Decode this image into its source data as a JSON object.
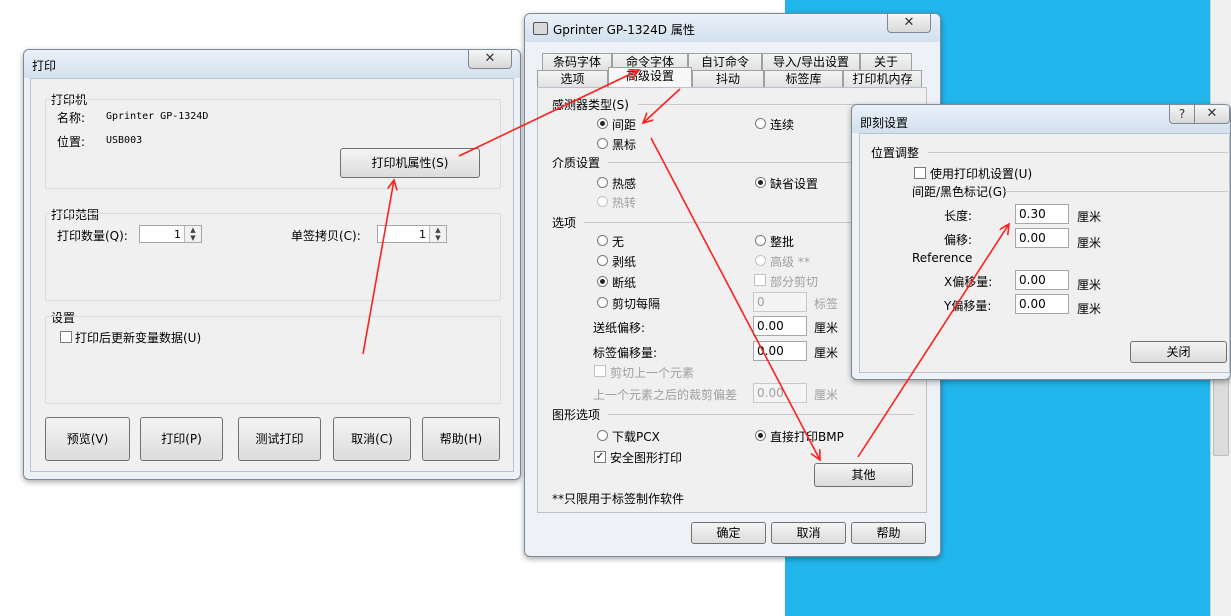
{
  "print_dialog": {
    "title": "打印",
    "close_glyph": "✕",
    "printer_group": "打印机",
    "name_label": "名称:",
    "name_value": "Gprinter GP-1324D",
    "location_label": "位置:",
    "location_value": "USB003",
    "properties_button": "打印机属性(S)",
    "range_group": "打印范围",
    "quantity_label": "打印数量(Q):",
    "quantity_value": "1",
    "copies_label": "单签拷贝(C):",
    "copies_value": "1",
    "settings_group": "设置",
    "update_vars_label": "打印后更新变量数据(U)",
    "buttons": {
      "preview": "预览(V)",
      "print": "打印(P)",
      "test_print": "测试打印",
      "cancel": "取消(C)",
      "help": "帮助(H)"
    }
  },
  "properties_dialog": {
    "title": "Gprinter GP-1324D 属性",
    "close_glyph": "✕",
    "tabs_row1": [
      "条码字体",
      "命令字体",
      "自订命令",
      "导入/导出设置",
      "关于"
    ],
    "tabs_row2": [
      "选项",
      "高级设置",
      "抖动",
      "标签库",
      "打印机内存"
    ],
    "active_tab": "高级设置",
    "sensor_group": "感测器类型(S)",
    "sensor_gap": "间距",
    "sensor_continuous": "连续",
    "sensor_black": "黑标",
    "media_group": "介质设置",
    "media_thermal": "热感",
    "media_default": "缺省设置",
    "media_transfer": "热转",
    "options_group": "选项",
    "opt_none": "无",
    "opt_batch": "整批",
    "opt_peel": "剥纸",
    "opt_advanced": "高级 **",
    "opt_tear": "断纸",
    "opt_partial_cut": "部分剪切",
    "opt_cut_every": "剪切每隔",
    "opt_cut_every_value": "0",
    "opt_cut_every_unit": "标签",
    "feed_offset_label": "送纸偏移:",
    "feed_offset_value": "0.00",
    "feed_offset_unit": "厘米",
    "label_offset_label": "标签偏移量:",
    "label_offset_value": "0.00",
    "label_offset_unit": "厘米",
    "cut_prev_label": "剪切上一个元素",
    "cut_after_label": "上一个元素之后的裁剪偏差",
    "cut_after_value": "0.00",
    "cut_after_unit": "厘米",
    "graphics_group": "图形选项",
    "gfx_pcx": "下载PCX",
    "gfx_bmp": "直接打印BMP",
    "gfx_safe": "安全图形打印",
    "other_button": "其他",
    "footnote": "**只限用于标签制作软件",
    "ok_button": "确定",
    "cancel_button": "取消",
    "help_button": "帮助"
  },
  "immediate_dialog": {
    "title": "即刻设置",
    "help_glyph": "?",
    "close_glyph": "✕",
    "position_group": "位置调整",
    "use_printer_label": "使用打印机设置(U)",
    "gap_group": "间距/黑色标记(G)",
    "length_label": "长度:",
    "length_value": "0.30",
    "offset_label": "偏移:",
    "offset_value": "0.00",
    "unit": "厘米",
    "reference_label": "Reference",
    "x_offset_label": "X偏移量:",
    "x_offset_value": "0.00",
    "y_offset_label": "Y偏移量:",
    "y_offset_value": "0.00",
    "close_button": "关闭"
  },
  "colors": {
    "arrow": "#ff2020",
    "desktop": "#22b6ec"
  }
}
